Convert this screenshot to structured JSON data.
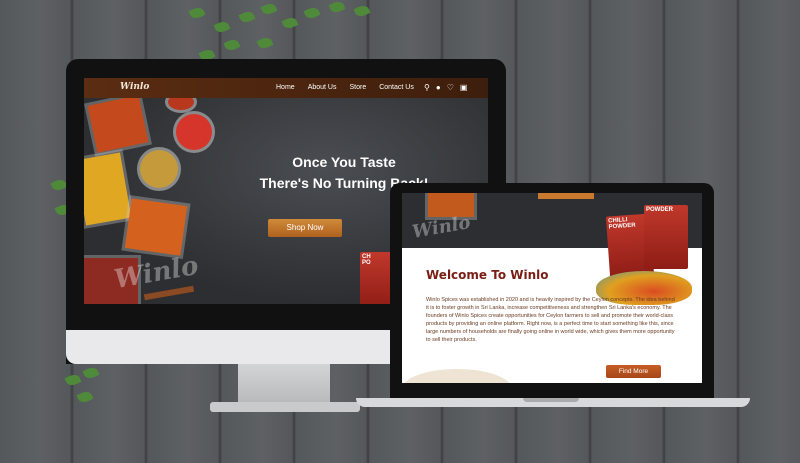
{
  "desktop": {
    "brand": "Winlo",
    "nav": [
      "Home",
      "About Us",
      "Store",
      "Contact Us"
    ],
    "nav_icons": [
      "search-icon",
      "user-icon",
      "heart-icon",
      "cart-icon"
    ],
    "hero_line1": "Once You Taste",
    "hero_line2": "There's No Turning Back!",
    "cta": "Shop Now",
    "watermark": "Winlo",
    "package_text": "CH\nPO"
  },
  "laptop": {
    "watermark": "Winlo",
    "heading": "Welcome To Winlo",
    "paragraph": "Winlo Spices was established in 2020 and is heavily inspired by the Ceylon concepts. The idea behind it is to foster growth in Sri Lanka, increase competitiveness and strengthen Sri Lanka's economy. The founders of Winlo Spices create opportunities for Ceylon farmers to sell and promote their world-class products by providing an online platform. Right now, is a perfect time to start something like this, since large numbers of households are finally going online in world wide, which gives them more opportunity to sell their products.",
    "cta": "Find More",
    "package1": "CHILLI POWDER",
    "package2": "POWDER"
  },
  "colors": {
    "nav_brown": "#5b2d12",
    "accent_orange": "#c97a2f",
    "heading_red": "#7a1d14"
  }
}
